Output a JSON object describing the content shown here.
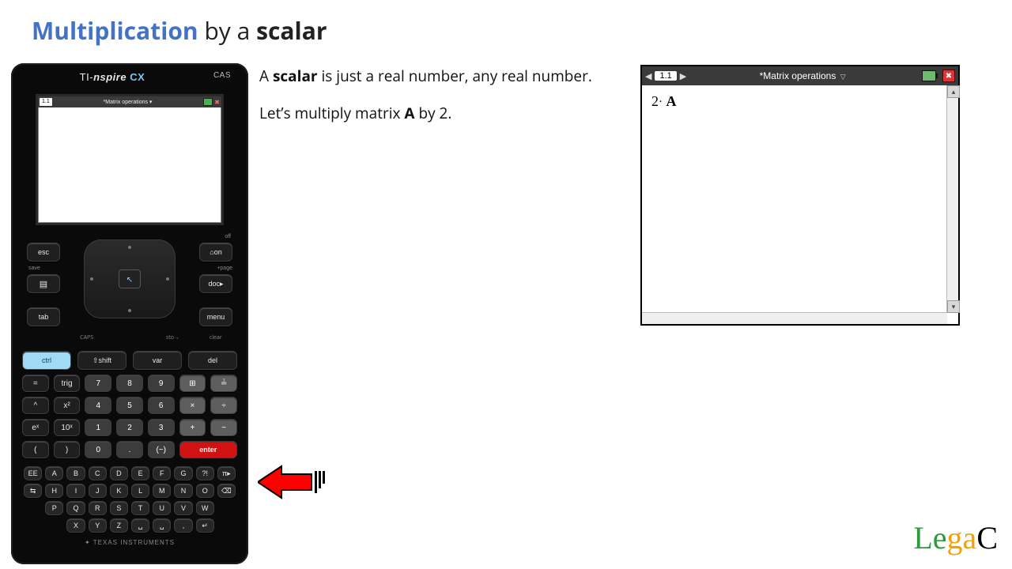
{
  "title": {
    "word1": "Multiplication",
    "mid": " by a ",
    "word2": "scalar"
  },
  "para1": {
    "pre": "A ",
    "bold": "scalar",
    "post": " is just a real number, any real number."
  },
  "para2": {
    "pre": "Let’s multiply matrix ",
    "bold": "A",
    "post": " by 2."
  },
  "calc": {
    "brand_ti": "TI-",
    "brand_nspire": "nspire",
    "brand_cx": " CX",
    "brand_cas": "CAS",
    "lcd": {
      "tab": "1.1",
      "doc": "*Matrix operations ▾"
    },
    "cluster": {
      "esc": "esc",
      "on": "⌂on",
      "scratch": "▤",
      "doc": "doc▸",
      "tab": "tab",
      "menu": "menu",
      "off": "off",
      "save": "save",
      "page": "+page",
      "nav": "↖"
    },
    "funcrow": {
      "ctrl": "ctrl",
      "shift": "⇧shift",
      "var": "var",
      "del": "del"
    },
    "funclbls": [
      "",
      "CAPS",
      "",
      "sto→",
      "clear"
    ],
    "grid": [
      {
        "t": "=",
        "c": ""
      },
      {
        "t": "trig",
        "c": ""
      },
      {
        "t": "7",
        "c": "num"
      },
      {
        "t": "8",
        "c": "num"
      },
      {
        "t": "9",
        "c": "num"
      },
      {
        "t": "⊞",
        "c": "gray"
      },
      {
        "t": "≟",
        "c": "gray"
      },
      {
        "t": "^",
        "c": ""
      },
      {
        "t": "x²",
        "c": ""
      },
      {
        "t": "4",
        "c": "num"
      },
      {
        "t": "5",
        "c": "num"
      },
      {
        "t": "6",
        "c": "num"
      },
      {
        "t": "×",
        "c": "gray"
      },
      {
        "t": "÷",
        "c": "gray"
      },
      {
        "t": "eˣ",
        "c": ""
      },
      {
        "t": "10ˣ",
        "c": ""
      },
      {
        "t": "1",
        "c": "num"
      },
      {
        "t": "2",
        "c": "num"
      },
      {
        "t": "3",
        "c": "num"
      },
      {
        "t": "+",
        "c": "gray"
      },
      {
        "t": "−",
        "c": "gray"
      },
      {
        "t": "(",
        "c": ""
      },
      {
        "t": ")",
        "c": ""
      },
      {
        "t": "0",
        "c": "num"
      },
      {
        "t": ".",
        "c": "num"
      },
      {
        "t": "(−)",
        "c": "num"
      },
      {
        "t": "enter",
        "c": "enter col2"
      }
    ],
    "alpha_rows": [
      [
        "EE",
        "A",
        "B",
        "C",
        "D",
        "E",
        "F",
        "G",
        "?!",
        "π▸"
      ],
      [
        "⇆",
        "H",
        "I",
        "J",
        "K",
        "L",
        "M",
        "N",
        "O",
        "⌫"
      ],
      [
        "",
        "P",
        "Q",
        "R",
        "S",
        "T",
        "U",
        "V",
        "W",
        ""
      ],
      [
        "",
        "",
        "X",
        "Y",
        "Z",
        "␣",
        "␣",
        ",",
        "↵",
        ""
      ]
    ],
    "ti_logo": "✦ TEXAS INSTRUMENTS"
  },
  "panel": {
    "page": "1.1",
    "name": "*Matrix operations",
    "expr_num": "2",
    "expr_var": "A"
  },
  "logo": {
    "L": "L",
    "e": "e",
    "g": "g",
    "a": "a",
    "C": "C"
  }
}
